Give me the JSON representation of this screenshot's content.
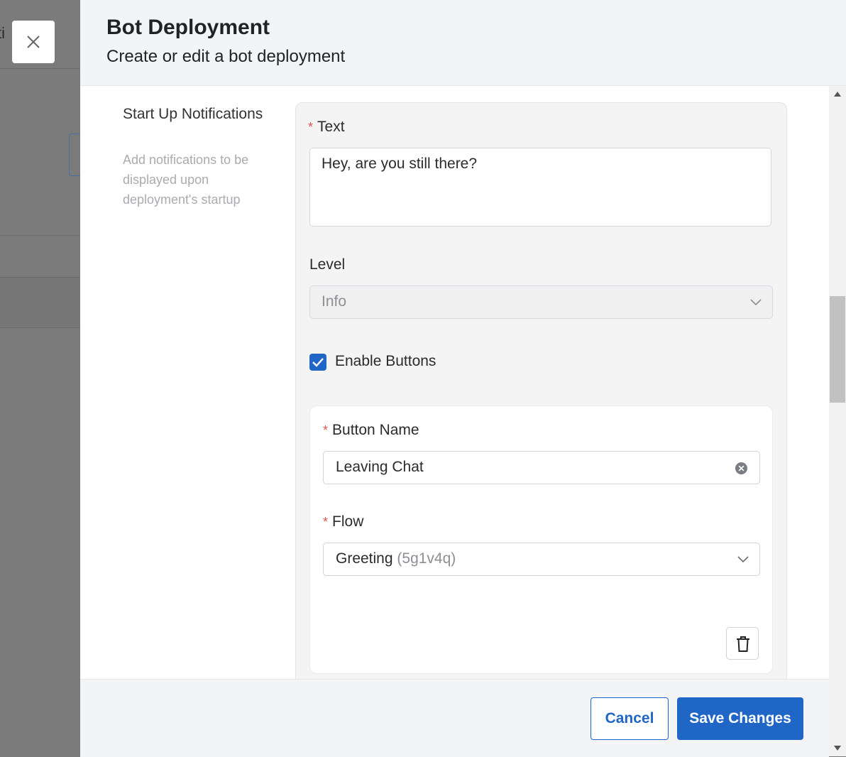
{
  "backdrop": {
    "partial_text": "ti"
  },
  "header": {
    "title": "Bot Deployment",
    "subtitle": "Create or edit a bot deployment"
  },
  "section": {
    "title": "Start Up Notifications",
    "description": "Add notifications to be displayed upon deployment's startup"
  },
  "notification": {
    "text_label": "Text",
    "text_value": "Hey, are you still there?",
    "level_label": "Level",
    "level_value": "Info",
    "enable_buttons_label": "Enable Buttons",
    "enable_buttons_checked": true
  },
  "button_item": {
    "name_label": "Button Name",
    "name_value": "Leaving Chat",
    "flow_label": "Flow",
    "flow_value": "Greeting",
    "flow_id": "(5g1v4q)"
  },
  "footer": {
    "cancel_label": "Cancel",
    "save_label": "Save Changes"
  },
  "colors": {
    "primary": "#1f66c7",
    "required": "#e05454",
    "header_bg": "#f3f4f6"
  },
  "icons": [
    "close-icon",
    "chevron-down-icon",
    "check-icon",
    "clear-circle-icon",
    "trash-icon",
    "scroll-up-arrow",
    "scroll-down-arrow"
  ]
}
